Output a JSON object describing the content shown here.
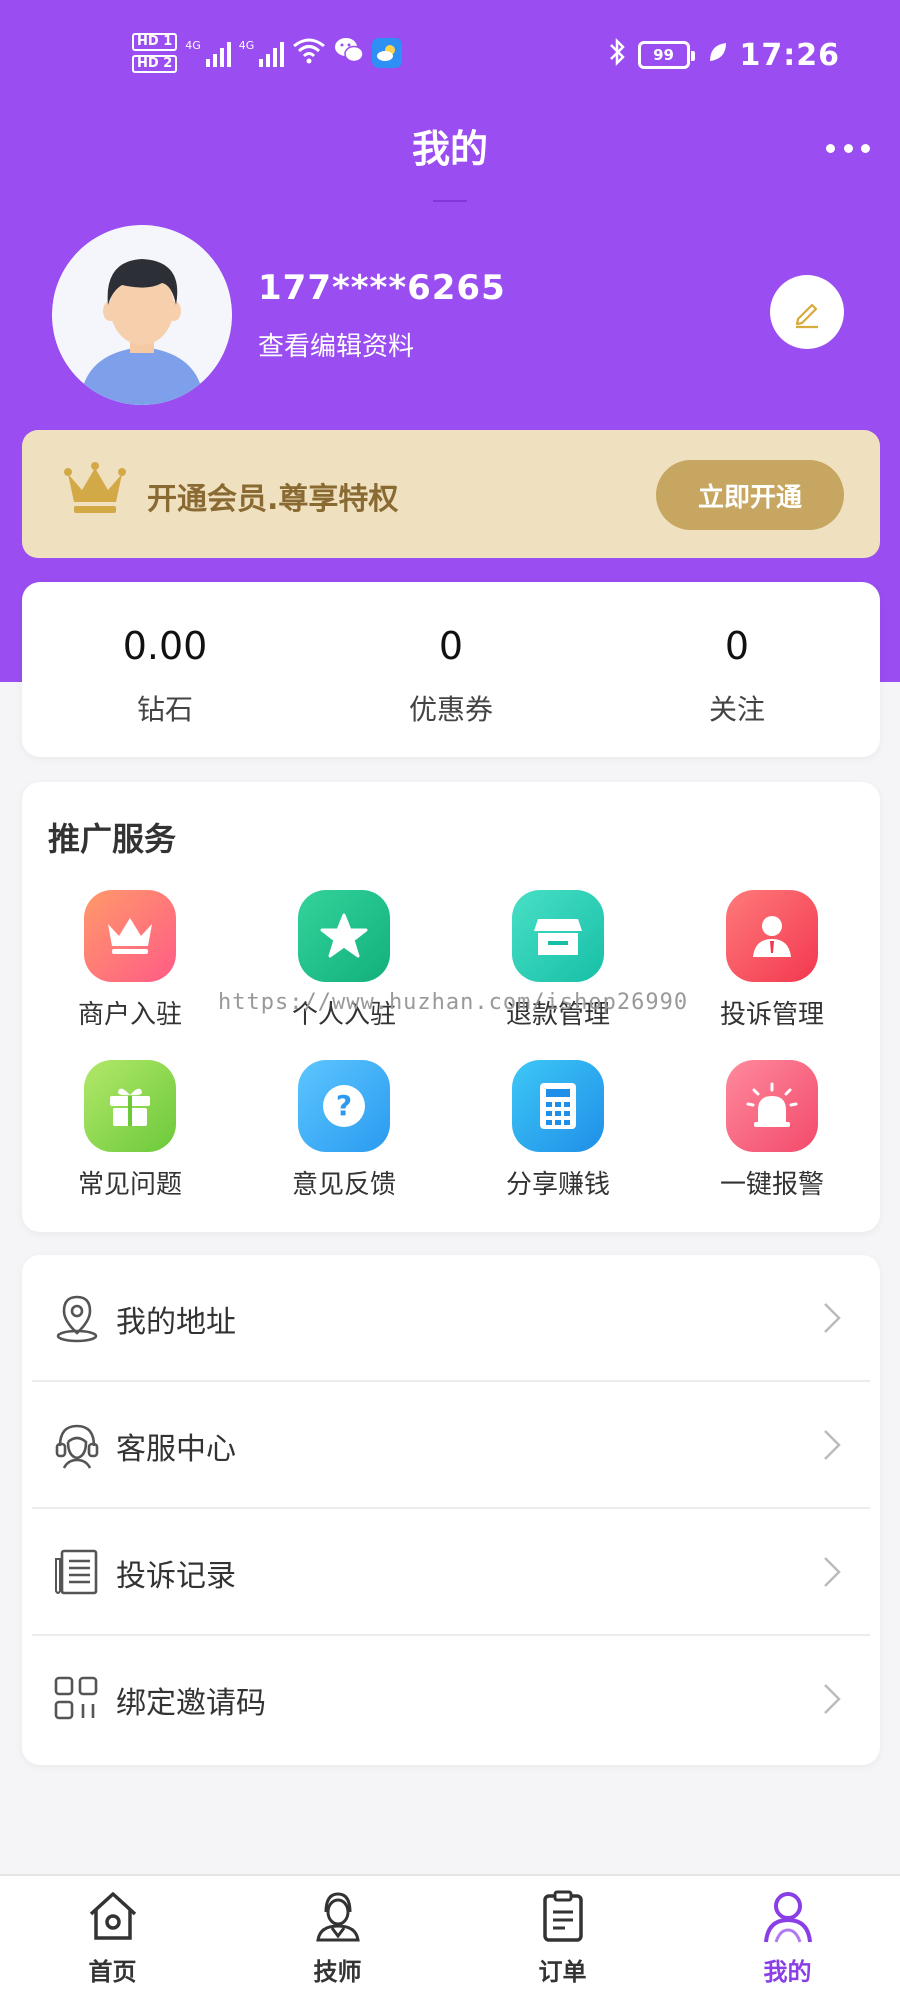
{
  "status_bar": {
    "hd1": "HD 1",
    "hd2": "HD 2",
    "net1": "4G",
    "net2": "4G",
    "battery": "99",
    "time": "17:26"
  },
  "header": {
    "title": "我的"
  },
  "profile": {
    "phone": "177****6265",
    "edit_text": "查看编辑资料"
  },
  "vip": {
    "text": "开通会员.尊享特权",
    "button": "立即开通"
  },
  "stats": [
    {
      "value": "0.00",
      "label": "钻石"
    },
    {
      "value": "0",
      "label": "优惠券"
    },
    {
      "value": "0",
      "label": "关注"
    }
  ],
  "services": {
    "title": "推广服务",
    "items": [
      {
        "label": "商户入驻",
        "icon": "crown-icon"
      },
      {
        "label": "个人入驻",
        "icon": "star-icon"
      },
      {
        "label": "退款管理",
        "icon": "store-icon"
      },
      {
        "label": "投诉管理",
        "icon": "person-icon"
      },
      {
        "label": "常见问题",
        "icon": "gift-icon"
      },
      {
        "label": "意见反馈",
        "icon": "question-icon"
      },
      {
        "label": "分享赚钱",
        "icon": "calculator-icon"
      },
      {
        "label": "一键报警",
        "icon": "alarm-icon"
      }
    ]
  },
  "watermark": "https://www.huzhan.com/ishop26990",
  "menu": [
    {
      "label": "我的地址",
      "icon": "location-pin-icon"
    },
    {
      "label": "客服中心",
      "icon": "headset-icon"
    },
    {
      "label": "投诉记录",
      "icon": "notepad-icon"
    },
    {
      "label": "绑定邀请码",
      "icon": "qr-grid-icon"
    }
  ],
  "tabs": [
    {
      "label": "首页",
      "icon": "home-icon"
    },
    {
      "label": "技师",
      "icon": "technician-icon"
    },
    {
      "label": "订单",
      "icon": "clipboard-icon"
    },
    {
      "label": "我的",
      "icon": "user-icon",
      "active": true
    }
  ],
  "colors": {
    "brand_purple": "#9a4df0",
    "vip_bg": "#efe1bf",
    "vip_button": "#c6a660",
    "active_tab": "#8a3fe6"
  }
}
